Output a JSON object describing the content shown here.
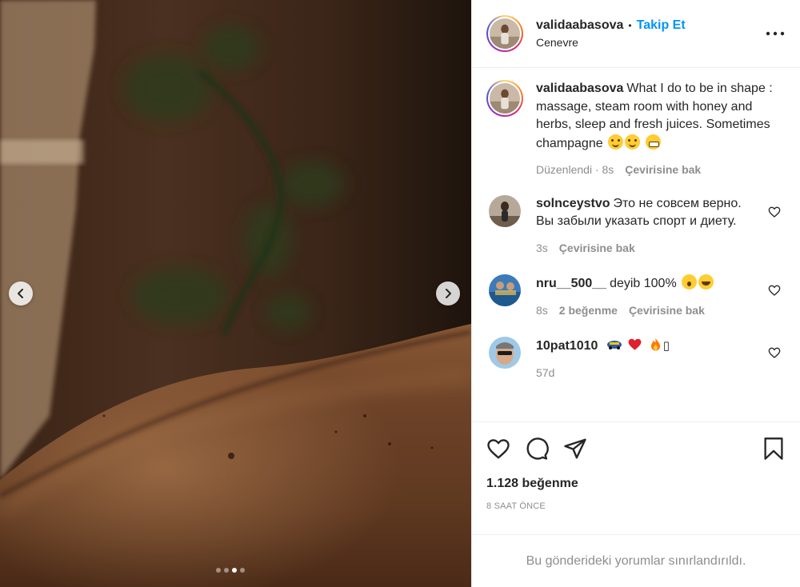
{
  "media": {
    "carousel_dots": 4,
    "active_dot_index": 2
  },
  "post": {
    "author": "validaabasova",
    "separator": "•",
    "follow_label": "Takip Et",
    "location": "Cenevre",
    "caption": "What I do to be in shape : massage, steam room with honey and herbs, sleep and fresh juices. Sometimes champagne",
    "caption_meta_edited": "Düzenlendi · 8s",
    "see_translation": "Çevirisine bak"
  },
  "comments": [
    {
      "username": "solnceystvo",
      "text": "Это не совсем верно. Вы забыли указать спорт и диету.",
      "time": "3s",
      "see_translation": "Çevirisine bak"
    },
    {
      "username": "nru__500__",
      "text": "deyib 100%",
      "time": "8s",
      "likes": "2 beğenme",
      "see_translation": "Çevirisine bak"
    },
    {
      "username": "10pat1010",
      "text_tail": "",
      "box_char": "▯",
      "time": "57d"
    }
  ],
  "footer": {
    "likes": "1.128 beğenme",
    "posted": "8 SAAT ÖNCE",
    "comments_limited": "Bu gönderideki yorumlar sınırlandırıldı."
  },
  "colors": {
    "accent": "#0095f6",
    "text": "#262626",
    "muted": "#8e8e8e",
    "border": "#efefef"
  },
  "icons": [
    "chevron-left-icon",
    "chevron-right-icon",
    "more-options-icon",
    "like-icon",
    "comment-icon",
    "share-icon",
    "bookmark-icon",
    "small-heart-icon"
  ]
}
